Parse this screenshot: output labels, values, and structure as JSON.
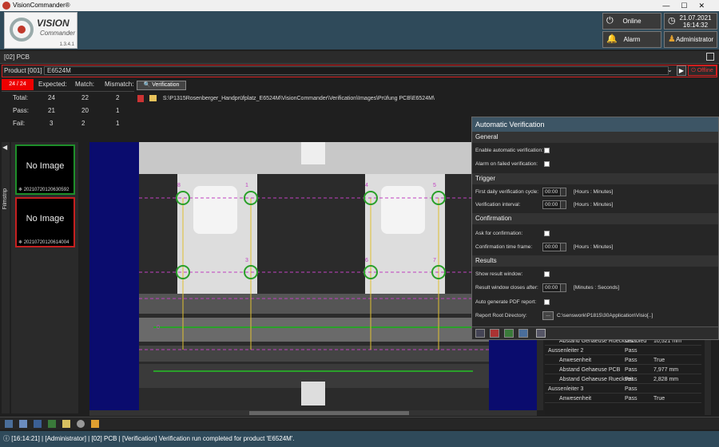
{
  "window": {
    "title": "VisionCommander®"
  },
  "logo": {
    "line1": "VISION",
    "line2": "Commander",
    "version": "1.3.4.1"
  },
  "header": {
    "online_label": "Online",
    "alarm_label": "Alarm",
    "date": "21.07.2021",
    "time": "16:14:32",
    "user_label": "Administrator"
  },
  "panel": {
    "title": "[02] PCB"
  },
  "product": {
    "label": "Product [001]",
    "value": "E6524M",
    "offline_label": "Offline"
  },
  "stats": {
    "counter": "24 / 24",
    "columns": [
      "Expected:",
      "Match:",
      "Mismatch:"
    ],
    "rows": [
      {
        "label": "Total:",
        "values": [
          "24",
          "22",
          "2"
        ]
      },
      {
        "label": "Pass:",
        "values": [
          "21",
          "20",
          "1"
        ]
      },
      {
        "label": "Fail:",
        "values": [
          "3",
          "2",
          "1"
        ]
      }
    ],
    "verification_button": "Verification",
    "path": "S:\\P1315Rosenberger_Handprüfplatz_E6524M\\VisionCommander\\Verification\\Images\\Prüfung PCB\\E6524M\\"
  },
  "filmstrip": {
    "tab_label": "Filmstrip",
    "items": [
      {
        "text": "No Image",
        "caption": "20210720120630592",
        "status_color": "#1e8f2a"
      },
      {
        "text": "No Image",
        "caption": "20210720120614004",
        "status_color": "#c62020"
      }
    ]
  },
  "results": {
    "rows": [
      {
        "name": "Abstand Gehaeuse Rueckseit",
        "status": "Disabled",
        "value": "10,521 mm",
        "indent": 1
      },
      {
        "name": "Aussenleiter 2",
        "status": "Pass",
        "value": "",
        "indent": 0
      },
      {
        "name": "Anwesenheit",
        "status": "Pass",
        "value": "True",
        "indent": 1
      },
      {
        "name": "Abstand Gehaeuse PCB",
        "status": "Pass",
        "value": "7,977 mm",
        "indent": 1
      },
      {
        "name": "Abstand Gehaeuse Rueckseit",
        "status": "Pass",
        "value": "2,828 mm",
        "indent": 1
      },
      {
        "name": "Aussenleiter 3",
        "status": "Pass",
        "value": "",
        "indent": 0
      },
      {
        "name": "Anwesenheit",
        "status": "Pass",
        "value": "True",
        "indent": 1
      }
    ]
  },
  "popup": {
    "title": "Automatic Verification",
    "general": {
      "header": "General",
      "enable_label": "Enable automatic verification:",
      "alarm_label": "Alarm on failed verification:"
    },
    "trigger": {
      "header": "Trigger",
      "first_daily_label": "First daily verification cycle:",
      "first_daily_value": "00:00",
      "first_daily_unit": "[Hours : Minutes]",
      "interval_label": "Verification interval:",
      "interval_value": "00:00",
      "interval_unit": "[Hours : Minutes]"
    },
    "confirmation": {
      "header": "Confirmation",
      "ask_label": "Ask for confirmation:",
      "time_label": "Confirmation time frame:",
      "time_value": "00:00",
      "time_unit": "[Hours : Minutes]"
    },
    "results": {
      "header": "Results",
      "show_label": "Show result window:",
      "closes_label": "Result window closes after:",
      "closes_value": "00:00",
      "closes_unit": "[Minutes : Seconds]",
      "pdf_label": "Auto generate PDF report:",
      "dir_label": "Report Root Directory:",
      "dir_button": "...",
      "dir_value": "C:\\senswork\\P1815\\30Application\\Visio[..]"
    }
  },
  "viewer": {
    "markers": [
      "1",
      "2",
      "3",
      "4",
      "5",
      "6",
      "7",
      "8",
      "0"
    ]
  },
  "statusbar": {
    "text": "[16:14:21] | [Administrator] | [02] PCB | [Verification] Verification run completed for product 'E6524M'."
  }
}
